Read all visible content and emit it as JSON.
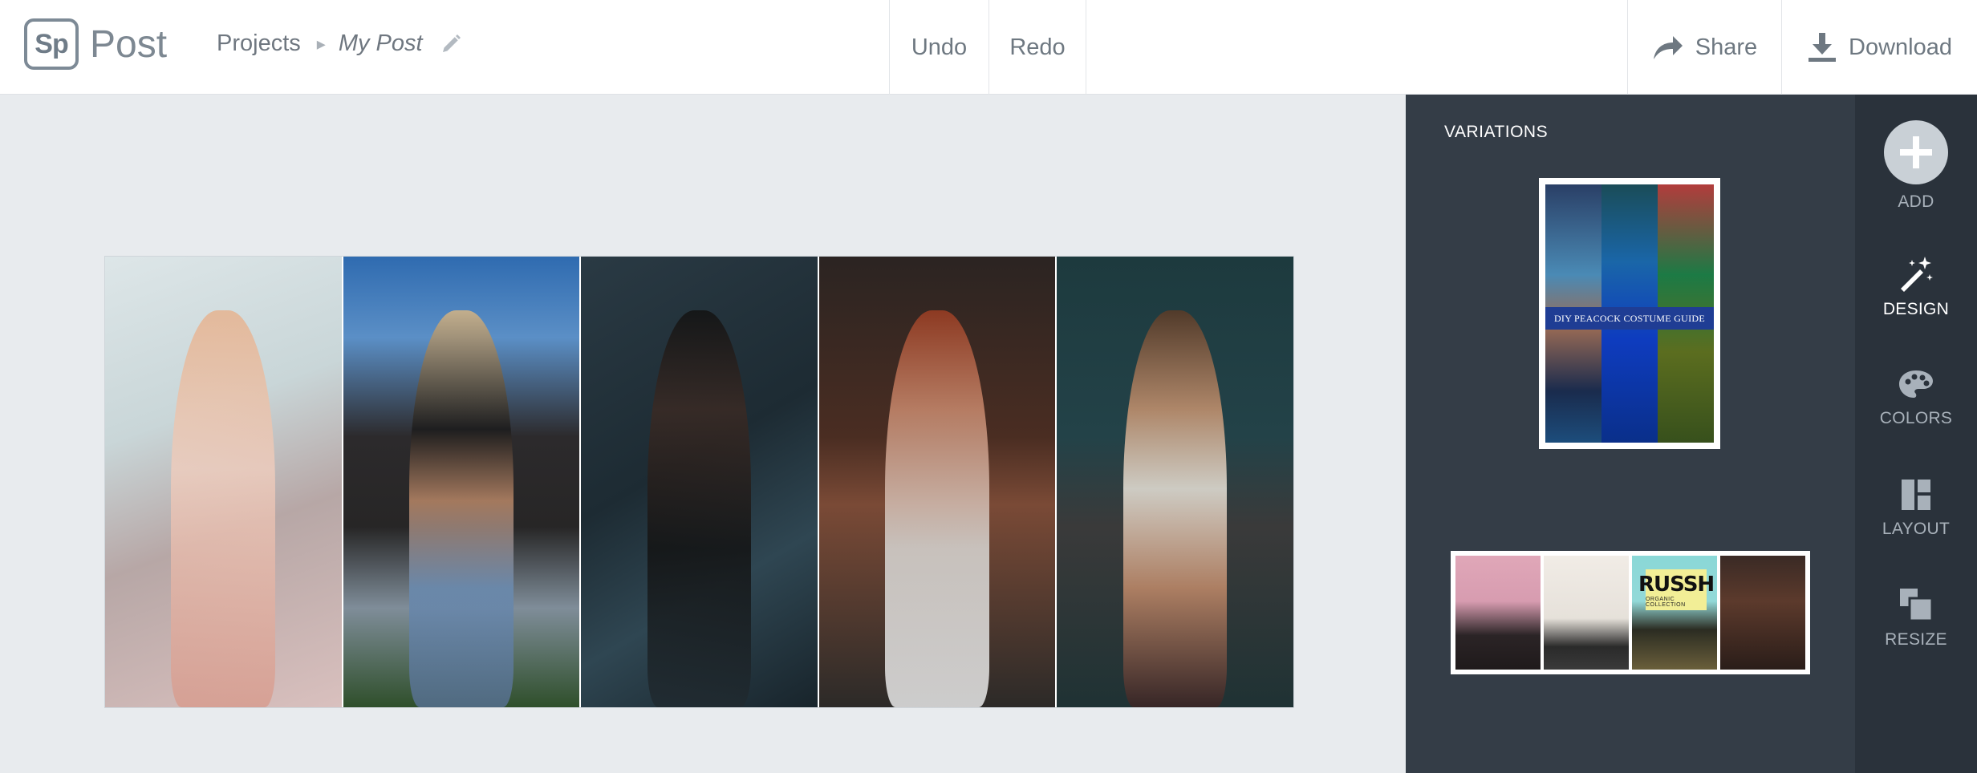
{
  "app": {
    "logo_mark": "Sp",
    "name": "Post"
  },
  "breadcrumb": {
    "parent": "Projects",
    "current": "My Post"
  },
  "toolbar": {
    "undo_label": "Undo",
    "redo_label": "Redo",
    "share_label": "Share",
    "download_label": "Download"
  },
  "variations": {
    "title": "VARIATIONS",
    "cards": [
      {
        "banner_text": "DIY PEACOCK COSTUME GUIDE"
      },
      {
        "brand_text": "RUSSH",
        "brand_subtext": "ORGANIC COLLECTION"
      }
    ]
  },
  "tools": [
    {
      "label": "ADD",
      "icon": "plus-circle-icon"
    },
    {
      "label": "DESIGN",
      "icon": "magic-wand-icon"
    },
    {
      "label": "COLORS",
      "icon": "palette-icon"
    },
    {
      "label": "LAYOUT",
      "icon": "layout-icon"
    },
    {
      "label": "RESIZE",
      "icon": "resize-icon"
    }
  ],
  "colors": {
    "topbar_bg": "#ffffff",
    "canvas_bg": "#e8ebee",
    "variations_bg": "#343d47",
    "rail_bg": "#2a323b"
  }
}
